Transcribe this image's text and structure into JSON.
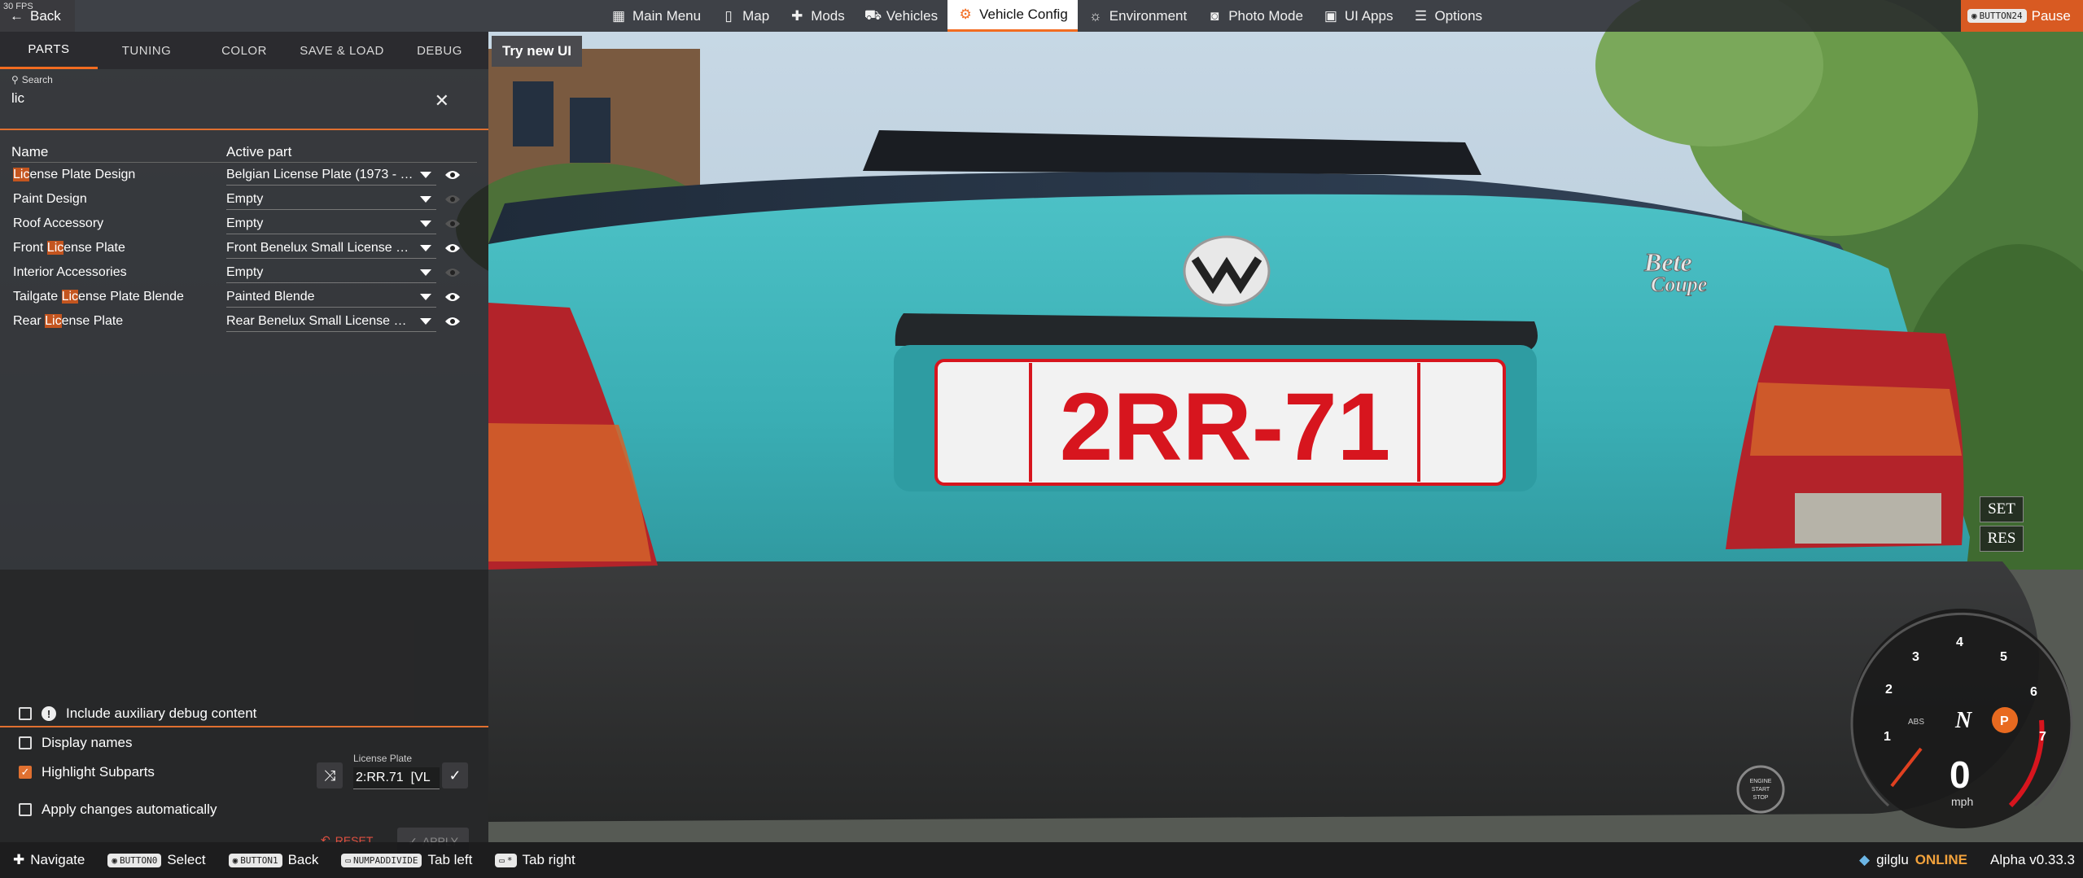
{
  "fps_label": "30 FPS",
  "topbar": {
    "back_label": "Back",
    "menu": [
      {
        "icon": "grid-icon",
        "label": "Main Menu",
        "active": false
      },
      {
        "icon": "map-icon",
        "label": "Map",
        "active": false
      },
      {
        "icon": "puzzle-icon",
        "label": "Mods",
        "active": false
      },
      {
        "icon": "car-icon",
        "label": "Vehicles",
        "active": false
      },
      {
        "icon": "engine-icon",
        "label": "Vehicle Config",
        "active": true
      },
      {
        "icon": "weather-icon",
        "label": "Environment",
        "active": false
      },
      {
        "icon": "camera-icon",
        "label": "Photo Mode",
        "active": false
      },
      {
        "icon": "apps-icon",
        "label": "UI Apps",
        "active": false
      },
      {
        "icon": "sliders-icon",
        "label": "Options",
        "active": false
      }
    ],
    "pause_key": "BUTTON24",
    "pause_label": "Pause"
  },
  "panel": {
    "tabs": [
      {
        "label": "PARTS",
        "active": true
      },
      {
        "label": "TUNING",
        "active": false
      },
      {
        "label": "COLOR",
        "active": false
      },
      {
        "label": "SAVE & LOAD",
        "active": false
      },
      {
        "label": "DEBUG",
        "active": false
      }
    ],
    "search_label": "Search",
    "search_value": "lic",
    "columns": {
      "name": "Name",
      "part": "Active part"
    },
    "rows": [
      {
        "pre": "",
        "match": "Lic",
        "post": "ense Plate Design",
        "part": "Belgian License Plate (1973 - 2…",
        "visible": true
      },
      {
        "pre": "Paint Design",
        "match": "",
        "post": "",
        "part": "Empty",
        "visible": false
      },
      {
        "pre": "Roof Accessory",
        "match": "",
        "post": "",
        "part": "Empty",
        "visible": false
      },
      {
        "pre": "Front ",
        "match": "Lic",
        "post": "ense Plate",
        "part": "Front Benelux Small License Pl…",
        "visible": true
      },
      {
        "pre": "Interior Accessories",
        "match": "",
        "post": "",
        "part": "Empty",
        "visible": false
      },
      {
        "pre": "Tailgate ",
        "match": "Lic",
        "post": "ense Plate Blende",
        "part": "Painted Blende",
        "visible": true
      },
      {
        "pre": "Rear ",
        "match": "Lic",
        "post": "ense Plate",
        "part": "Rear Benelux Small License Pla…",
        "visible": true
      }
    ],
    "options": [
      {
        "label": "Include auxiliary debug content",
        "checked": false,
        "info": true
      },
      {
        "label": "Display names",
        "checked": false,
        "info": false
      },
      {
        "label": "Highlight Subparts",
        "checked": true,
        "info": false
      },
      {
        "label": "Apply changes automatically",
        "checked": false,
        "info": false
      }
    ],
    "plate_label": "License Plate",
    "plate_value": "2:RR.71  [VL",
    "reset_label": "RESET",
    "apply_label": "APPLY"
  },
  "try_new_ui": "Try new UI",
  "plate_text": "2RR-71",
  "badge_text_1": "Bete",
  "badge_text_2": "Coupe",
  "cruise": {
    "set": "SET",
    "res": "RES"
  },
  "engine_button": [
    "ENGINE",
    "START",
    "STOP"
  ],
  "speedo": {
    "ticks": [
      "1",
      "2",
      "3",
      "4",
      "5",
      "6",
      "7"
    ],
    "abs": "ABS",
    "gear": "N",
    "park": "P",
    "speed": "0",
    "unit": "mph"
  },
  "bottombar": {
    "items": [
      {
        "key": "",
        "icon": "dpad-icon",
        "label": "Navigate"
      },
      {
        "key": "BUTTON0",
        "icon": "",
        "label": "Select"
      },
      {
        "key": "BUTTON1",
        "icon": "",
        "label": "Back"
      },
      {
        "key": "NUMPADDIVIDE",
        "icon": "",
        "label": "Tab left"
      },
      {
        "key": "*",
        "icon": "",
        "label": "Tab right"
      }
    ],
    "user": "gilglu",
    "status": "ONLINE",
    "version": "Alpha v0.33.3"
  },
  "colors": {
    "accent": "#f26c21",
    "car_body": "#3fb3b8",
    "plate_red": "#d7151e"
  }
}
